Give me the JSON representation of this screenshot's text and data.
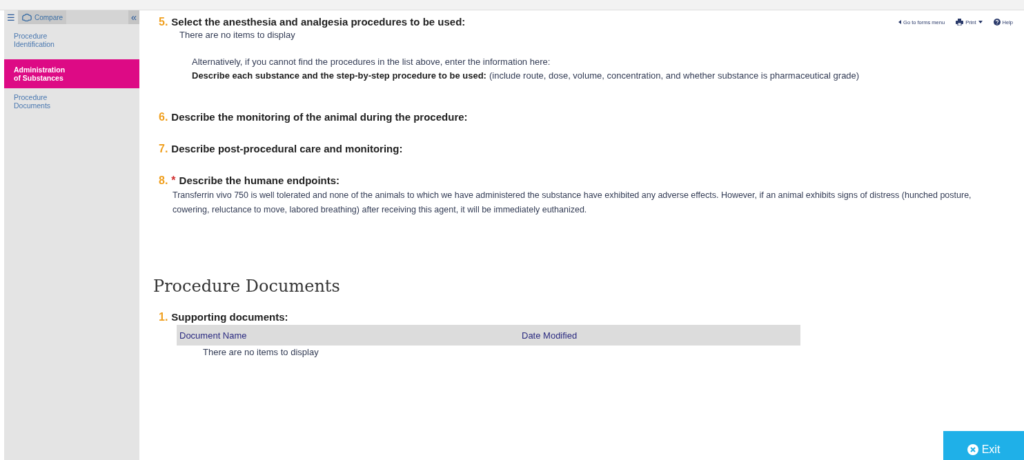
{
  "sidebar": {
    "menu_icon": "☰",
    "compare_label": "Compare",
    "collapse_icon": "«",
    "items": [
      {
        "label": "Procedure Identification",
        "selected": false
      },
      {
        "label": "Administration of Substances",
        "selected": true
      },
      {
        "label": "Procedure Documents",
        "selected": false
      }
    ]
  },
  "toolbar": {
    "links": [
      {
        "kind": "back",
        "label": "Go to forms menu"
      },
      {
        "kind": "print",
        "label": "Print"
      },
      {
        "kind": "help",
        "label": "Help"
      }
    ]
  },
  "questions": [
    {
      "number": "5.",
      "title": "Select the anesthesia and analgesia procedures to be used:",
      "empty_note": "There are no items to display",
      "alt_note": "Alternatively, if you cannot find the procedures in the list above, enter the information here:",
      "sub_label": "Describe each substance and the step-by-step procedure to be used:",
      "sub_hint": "(include route, dose, volume, concentration, and whether substance is pharmaceutical grade)"
    },
    {
      "number": "6.",
      "title": "Describe the monitoring of the animal during the procedure:"
    },
    {
      "number": "7.",
      "title": "Describe post-procedural care and monitoring:"
    },
    {
      "number": "8.",
      "required_mark": "*",
      "title": "Describe the humane endpoints:",
      "answer": "Transferrin vivo 750 is well tolerated and none of the animals to which we have administered the substance have exhibited any adverse effects. However, if an animal exhibits signs of distress (hunched posture, cowering, reluctance to move, labored breathing) after receiving this agent, it will be immediately euthanized."
    }
  ],
  "documents_section": {
    "heading": "Procedure Documents",
    "question": {
      "number": "1.",
      "title": "Supporting documents:"
    },
    "table": {
      "columns": [
        "Document Name",
        "Date Modified"
      ],
      "empty_note": "There are no items to display"
    }
  },
  "exit_button": {
    "label": "Exit"
  }
}
